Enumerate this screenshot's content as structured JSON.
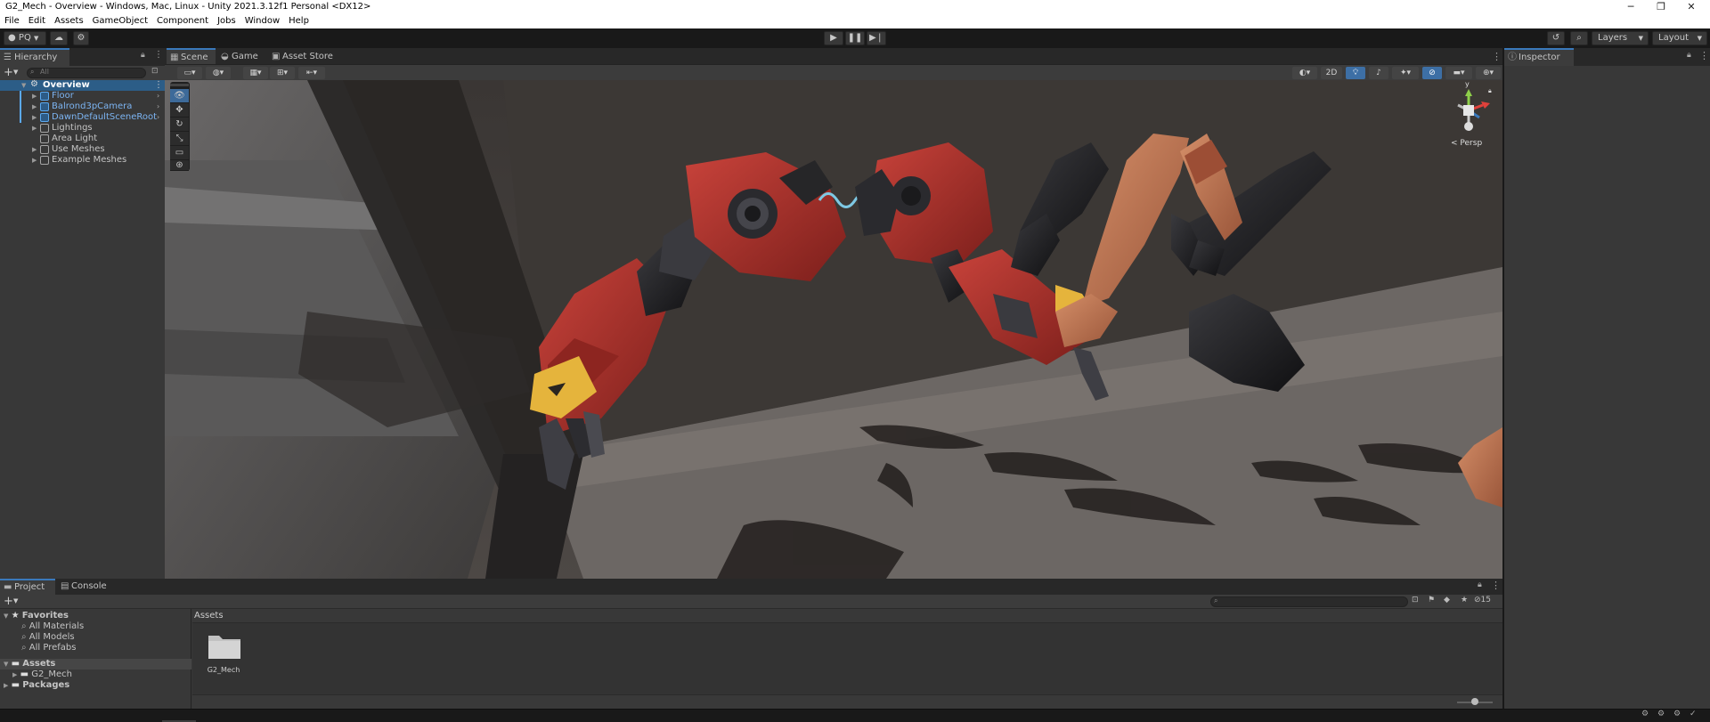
{
  "window": {
    "title": "G2_Mech - Overview - Windows, Mac, Linux - Unity 2021.3.12f1 Personal <DX12>",
    "controls": {
      "minimize": "─",
      "restore": "❐",
      "close": "✕"
    }
  },
  "menu": [
    "File",
    "Edit",
    "Assets",
    "GameObject",
    "Component",
    "Jobs",
    "Window",
    "Help"
  ],
  "toolbar": {
    "account": "PQ",
    "layers_label": "Layers",
    "layout_label": "Layout"
  },
  "hierarchy": {
    "tab_label": "Hierarchy",
    "search_placeholder": "All",
    "scene": "Overview",
    "items": [
      {
        "label": "Floor",
        "prefab": true
      },
      {
        "label": "Balrond3pCamera",
        "prefab": true
      },
      {
        "label": "DawnDefaultSceneRoot",
        "prefab": true
      },
      {
        "label": "Lightings",
        "prefab": false
      },
      {
        "label": "Area Light",
        "prefab": false
      },
      {
        "label": "Use Meshes",
        "prefab": false
      },
      {
        "label": "Example Meshes",
        "prefab": false
      }
    ]
  },
  "scene_tabs": [
    "Scene",
    "Game",
    "Asset Store"
  ],
  "scene_toolbar": {
    "mode_2d": "2D",
    "gizmo_label": "Persp",
    "axis_y": "y"
  },
  "inspector": {
    "tab_label": "Inspector"
  },
  "bottom_tabs": [
    "Project",
    "Console"
  ],
  "project": {
    "favorites_label": "Favorites",
    "favorites": [
      "All Materials",
      "All Models",
      "All Prefabs"
    ],
    "assets_label": "Assets",
    "asset_children": [
      "G2_Mech"
    ],
    "packages_label": "Packages",
    "breadcrumb": "Assets",
    "grid_items": [
      {
        "name": "G2_Mech"
      }
    ],
    "hidden_count": "15"
  },
  "colors": {
    "accent_blue": "#3a79bb",
    "panel_bg": "#383838",
    "dark_bg": "#191919",
    "mech_red": "#b8352f",
    "mech_yellow": "#e5b43c",
    "skin": "#c27a56"
  }
}
